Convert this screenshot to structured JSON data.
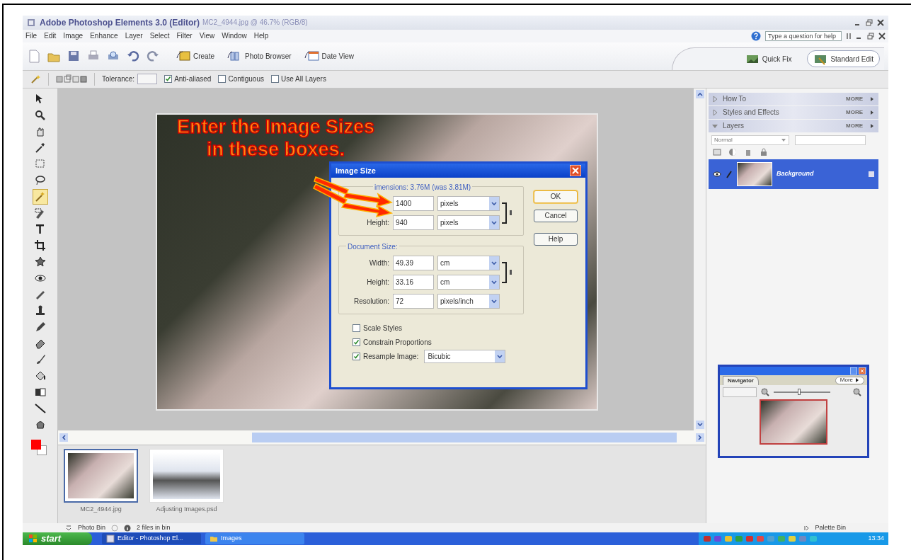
{
  "window": {
    "title": "Adobe Photoshop Elements 3.0 (Editor)",
    "document": "MC2_4944.jpg @ 46.7% (RGB/8)"
  },
  "menu": [
    "File",
    "Edit",
    "Image",
    "Enhance",
    "Layer",
    "Select",
    "Filter",
    "View",
    "Window",
    "Help"
  ],
  "help_field": {
    "placeholder": "Type a question for help"
  },
  "toolbar_buttons": [
    "Create",
    "Photo Browser",
    "Date View"
  ],
  "mode_tabs": [
    {
      "label": "Quick Fix",
      "selected": false
    },
    {
      "label": "Standard Edit",
      "selected": true
    }
  ],
  "options_bar": {
    "tolerance_label": "Tolerance:",
    "checkboxes": [
      {
        "label": "Anti-aliased",
        "checked": true
      },
      {
        "label": "Contiguous",
        "checked": false
      },
      {
        "label": "Use All Layers",
        "checked": false
      }
    ]
  },
  "tools": [
    {
      "selected": false
    },
    {
      "selected": false
    },
    {
      "selected": false
    },
    {
      "selected": false
    },
    {
      "selected": false
    },
    {
      "selected": false
    },
    {
      "selected": true
    },
    {
      "selected": false
    },
    {
      "selected": false
    },
    {
      "selected": false
    },
    {
      "selected": false
    },
    {
      "selected": false
    },
    {
      "selected": false
    },
    {
      "selected": false
    },
    {
      "selected": false
    },
    {
      "selected": false
    },
    {
      "selected": false
    },
    {
      "selected": false
    },
    {
      "selected": false
    },
    {
      "selected": false
    },
    {
      "selected": false
    }
  ],
  "annotation": [
    "Enter the Image Sizes",
    "in these boxes."
  ],
  "dialog": {
    "title": "Image Size",
    "pixel_dimensions": {
      "legend": "imensions: 3.76M (was 3.81M)",
      "rows": [
        {
          "value": "1400",
          "unit": "pixels"
        },
        {
          "label": "Height:",
          "value": "940",
          "unit": "pixels"
        }
      ]
    },
    "document_size": {
      "legend": "Document Size:",
      "rows": [
        {
          "label": "Width:",
          "value": "49.39",
          "unit": "cm"
        },
        {
          "label": "Height:",
          "value": "33.16",
          "unit": "cm"
        },
        {
          "label": "Resolution:",
          "value": "72",
          "unit": "pixels/inch"
        }
      ]
    },
    "checkboxes": [
      {
        "label": "Scale Styles",
        "checked": false
      },
      {
        "label": "Constrain Proportions",
        "checked": true
      },
      {
        "label": "Resample Image:",
        "checked": true,
        "dropdown": "Bicubic"
      }
    ],
    "buttons": [
      {
        "label": "OK",
        "default": true
      },
      {
        "label": "Cancel",
        "default": false
      },
      {
        "label": "Help",
        "default": false
      }
    ]
  },
  "palettes": [
    {
      "title": "How To",
      "expanded": false,
      "more": "MORE"
    },
    {
      "title": "Styles and Effects",
      "expanded": false,
      "more": "MORE"
    },
    {
      "title": "Layers",
      "expanded": true,
      "more": "MORE"
    }
  ],
  "layers": {
    "blend_mode": "Normal",
    "items": [
      {
        "name": "Background",
        "selected": true
      }
    ]
  },
  "navigator": {
    "tab": "Navigator",
    "more": "More",
    "zoom": {
      "level": 0.45
    }
  },
  "photo_bin": {
    "items": [
      {
        "name": "MC2_4944.jpg",
        "selected": true
      },
      {
        "name": "Adjusting Images.psd",
        "selected": false
      }
    ],
    "label": "Photo Bin",
    "count": "2 files in bin",
    "palette_bin": "Palette Bin"
  },
  "taskbar": {
    "start": "start",
    "tasks": [
      {
        "label": "Editor - Photoshop El...",
        "selected": true
      },
      {
        "label": "Images",
        "selected": false
      }
    ],
    "clock": "13:34"
  }
}
